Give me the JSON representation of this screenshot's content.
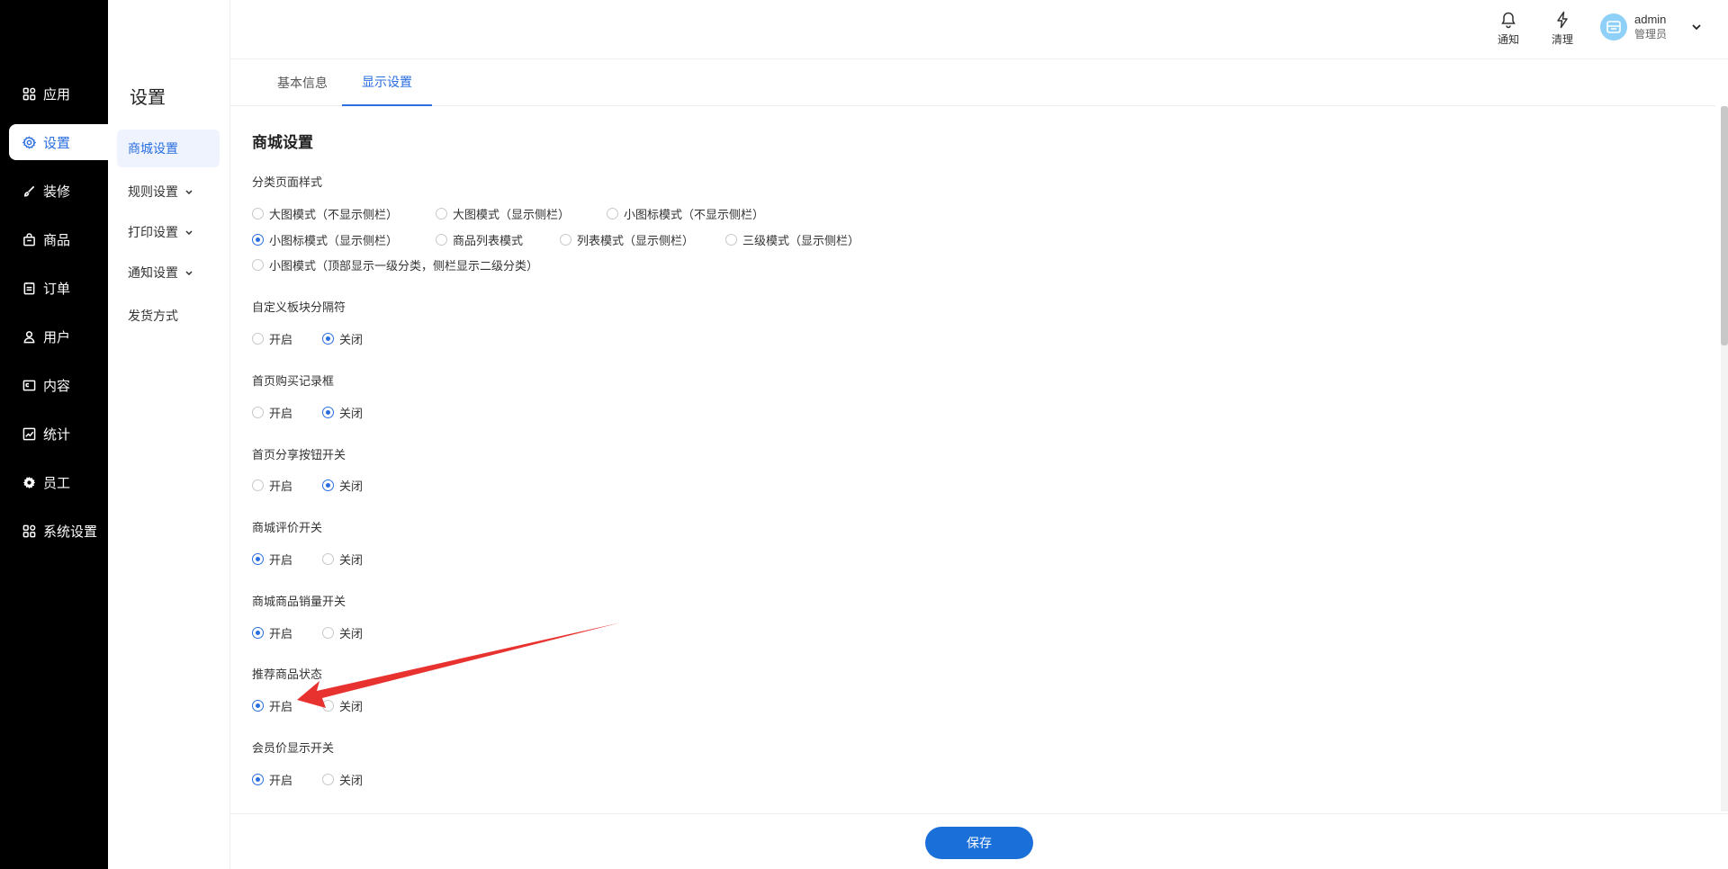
{
  "colors": {
    "accent": "#2a6ee0",
    "nav_bg": "#000000",
    "save_button": "#1a6fd9",
    "annotation_arrow": "#e8322f"
  },
  "leftnav": {
    "items": [
      {
        "label": "应用",
        "icon": "grid-icon"
      },
      {
        "label": "设置",
        "icon": "gear-icon",
        "active": true
      },
      {
        "label": "装修",
        "icon": "brush-icon"
      },
      {
        "label": "商品",
        "icon": "bag-icon"
      },
      {
        "label": "订单",
        "icon": "clipboard-icon"
      },
      {
        "label": "用户",
        "icon": "user-icon"
      },
      {
        "label": "内容",
        "icon": "document-icon"
      },
      {
        "label": "统计",
        "icon": "chart-icon"
      },
      {
        "label": "员工",
        "icon": "cog-icon"
      },
      {
        "label": "系统设置",
        "icon": "grid-icon"
      }
    ]
  },
  "subside": {
    "title": "设置",
    "items": [
      {
        "label": "商城设置",
        "active": true
      },
      {
        "label": "规则设置",
        "expandable": true
      },
      {
        "label": "打印设置",
        "expandable": true
      },
      {
        "label": "通知设置",
        "expandable": true
      },
      {
        "label": "发货方式"
      }
    ]
  },
  "header": {
    "notify_label": "通知",
    "clean_label": "清理",
    "user_name": "admin",
    "user_role": "管理员"
  },
  "tabs": [
    {
      "label": "基本信息"
    },
    {
      "label": "显示设置",
      "active": true
    }
  ],
  "section_title": "商城设置",
  "settings": [
    {
      "label": "分类页面样式",
      "options": [
        "大图模式（不显示侧栏）",
        "大图模式（显示侧栏）",
        "小图标模式（不显示侧栏）",
        "小图标模式（显示侧栏）",
        "商品列表模式",
        "列表模式（显示侧栏）",
        "三级模式（显示侧栏）",
        "小图模式（顶部显示一级分类，侧栏显示二级分类）"
      ],
      "selected": 3
    },
    {
      "label": "自定义板块分隔符",
      "options": [
        "开启",
        "关闭"
      ],
      "selected": 1
    },
    {
      "label": "首页购买记录框",
      "options": [
        "开启",
        "关闭"
      ],
      "selected": 1
    },
    {
      "label": "首页分享按钮开关",
      "options": [
        "开启",
        "关闭"
      ],
      "selected": 1
    },
    {
      "label": "商城评价开关",
      "options": [
        "开启",
        "关闭"
      ],
      "selected": 0
    },
    {
      "label": "商城商品销量开关",
      "options": [
        "开启",
        "关闭"
      ],
      "selected": 0
    },
    {
      "label": "推荐商品状态",
      "options": [
        "开启",
        "关闭"
      ],
      "selected": 0
    },
    {
      "label": "会员价显示开关",
      "options": [
        "开启",
        "关闭"
      ],
      "selected": 0
    }
  ],
  "footer": {
    "save_label": "保存"
  }
}
